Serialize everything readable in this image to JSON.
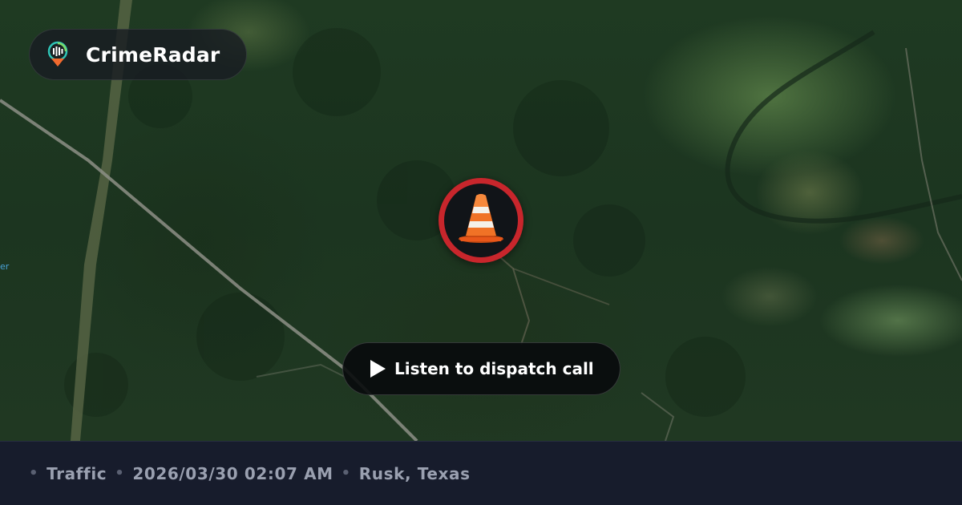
{
  "brand": {
    "name": "CrimeRadar",
    "logo_icon": "radar-pin-icon",
    "logo_colors": {
      "ring": "#2ec4b6",
      "pin": "#f26a2e"
    }
  },
  "incident": {
    "type": "Traffic",
    "icon": "traffic-cone-icon",
    "marker_color": "#c8262c",
    "datetime": "2026/03/30 02:07 AM",
    "location": "Rusk, Texas"
  },
  "player": {
    "label": "Listen to dispatch call",
    "icon": "play-icon"
  },
  "map": {
    "style": "satellite",
    "edge_label": "er"
  }
}
